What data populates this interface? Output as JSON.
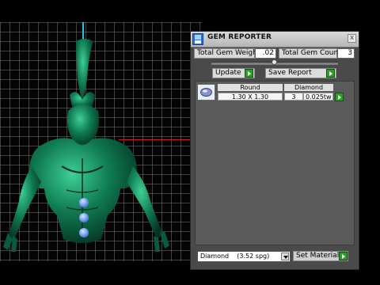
{
  "window": {
    "title": "GEM REPORTER",
    "close_symbol": "x"
  },
  "totals": {
    "weight_label": "Total Gem Weight",
    "weight_value": ".02",
    "count_label": "Total Gem Count",
    "count_value": "3"
  },
  "slider": {
    "position_fraction": 0.5
  },
  "actions": {
    "update_label": "Update",
    "save_report_label": "Save Report"
  },
  "gem_table": {
    "thumbnail_icon": "round-gem-icon",
    "shape": "Round",
    "size": "1.30 X 1.30",
    "material": "Diamond",
    "count": "3",
    "weight": "0.025tw"
  },
  "material_select": {
    "selected": "Diamond    (3.52 spg)"
  },
  "set_material_label": "Set Material",
  "colors": {
    "model_green": "#0f6a4a",
    "gem_blue": "#6d9dff",
    "accent_green": "#2c9e2c",
    "axis_cyan": "#1fc6e0",
    "axis_red": "#c81e1e"
  }
}
